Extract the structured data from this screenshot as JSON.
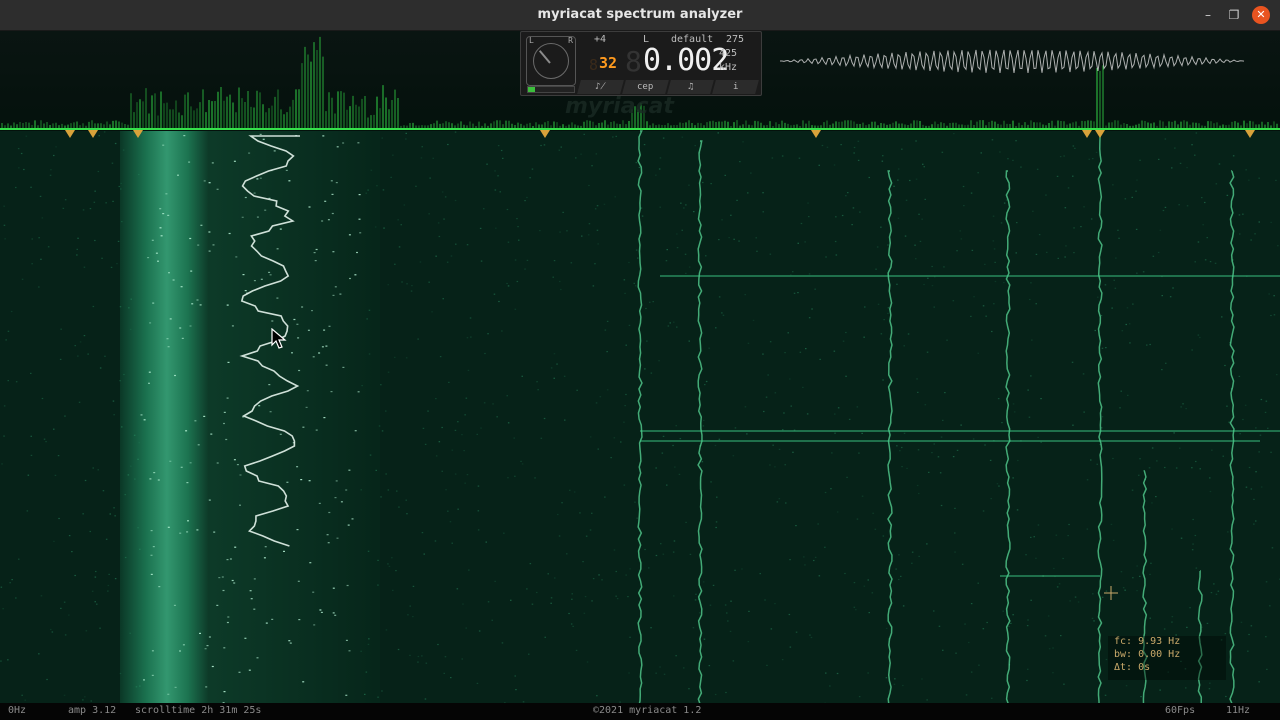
{
  "window": {
    "title": "myriacat spectrum analyzer",
    "controls": {
      "minimize": "–",
      "maximize": "❐",
      "close": "✕"
    }
  },
  "panel": {
    "left_label": "L",
    "right_label": "R",
    "gain": "+4",
    "channel": "L",
    "preset": "default",
    "count": "275",
    "small_value": "32",
    "small_value_prefix": "8",
    "big_value_prefix": "8",
    "frequency": "0.002",
    "sub_value": "425",
    "unit": "kHz",
    "tabs": [
      "♪̸",
      "cep",
      "♫",
      "i"
    ],
    "meter_level": 0.15
  },
  "watermark": "myriacat",
  "markers_count": 8,
  "info": {
    "fc": "fc: 9.93 Hz",
    "bw": "bw: 0.00 Hz",
    "dt": "Δt: 0s"
  },
  "status": {
    "left_freq": "0Hz",
    "amp": "amp  3.12",
    "scrolltime": "scrolltime  2h  31m  25s",
    "copyright": "©2021  myriacat  1.2",
    "fps": "60Fps",
    "right_freq": "11Hz"
  },
  "colors": {
    "accent_green": "#35e04a",
    "marker": "#d8a23a",
    "close": "#e95420"
  }
}
